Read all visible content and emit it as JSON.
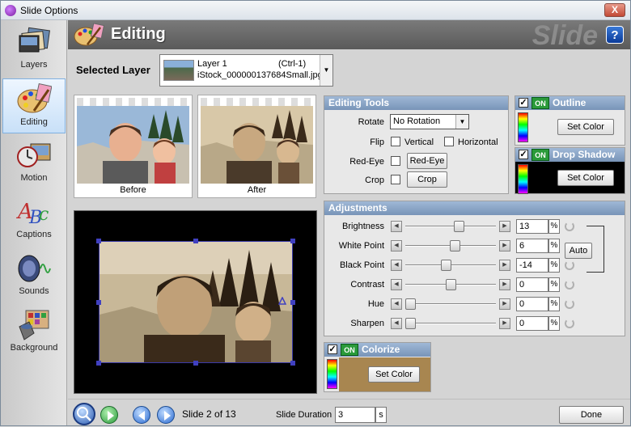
{
  "window": {
    "title": "Slide Options",
    "close_label": "X"
  },
  "sidebar": {
    "items": [
      {
        "label": "Layers",
        "icon": "layers-icon"
      },
      {
        "label": "Editing",
        "icon": "editing-icon",
        "active": true
      },
      {
        "label": "Motion",
        "icon": "motion-icon"
      },
      {
        "label": "Captions",
        "icon": "captions-icon"
      },
      {
        "label": "Sounds",
        "icon": "sounds-icon"
      },
      {
        "label": "Background",
        "icon": "background-icon"
      }
    ]
  },
  "header": {
    "title": "Editing",
    "watermark": "Slide",
    "help_label": "?"
  },
  "selected_layer": {
    "label": "Selected Layer",
    "layer_name": "Layer  1",
    "shortcut": "(Ctrl-1)",
    "file": "iStock_000000137684Small.jpg"
  },
  "thumbnails": {
    "before": "Before",
    "after": "After"
  },
  "editing_tools": {
    "title": "Editing Tools",
    "rotate_label": "Rotate",
    "rotate_value": "No Rotation",
    "flip_label": "Flip",
    "vertical_label": "Vertical",
    "horizontal_label": "Horizontal",
    "redeye_label": "Red-Eye",
    "redeye_button": "Red-Eye",
    "crop_label": "Crop",
    "crop_button": "Crop"
  },
  "outline": {
    "on": "ON",
    "title": "Outline",
    "button": "Set Color"
  },
  "drop_shadow": {
    "on": "ON",
    "title": "Drop Shadow",
    "button": "Set Color"
  },
  "adjustments": {
    "title": "Adjustments",
    "auto_label": "Auto",
    "rows": [
      {
        "label": "Brightness",
        "value": "13",
        "unit": "%",
        "level": 0.6
      },
      {
        "label": "White Point",
        "value": "6",
        "unit": "%",
        "level": 0.55
      },
      {
        "label": "Black Point",
        "value": "-14",
        "unit": "%",
        "level": 0.44
      },
      {
        "label": "Contrast",
        "value": "0",
        "unit": "%",
        "level": 0.5
      },
      {
        "label": "Hue",
        "value": "0",
        "unit": "%",
        "level": 0.0
      },
      {
        "label": "Sharpen",
        "value": "0",
        "unit": "%",
        "level": 0.0
      }
    ]
  },
  "colorize": {
    "on": "ON",
    "title": "Colorize",
    "button": "Set Color",
    "color": "#a88650"
  },
  "footer": {
    "slide_text": "Slide 2 of 13",
    "duration_label": "Slide Duration",
    "duration_value": "3",
    "duration_unit": "s",
    "done_label": "Done"
  },
  "colors": {
    "panel_header": "#7894b8",
    "active_tab": "#c8e0f8",
    "sepia": "#a88650"
  }
}
